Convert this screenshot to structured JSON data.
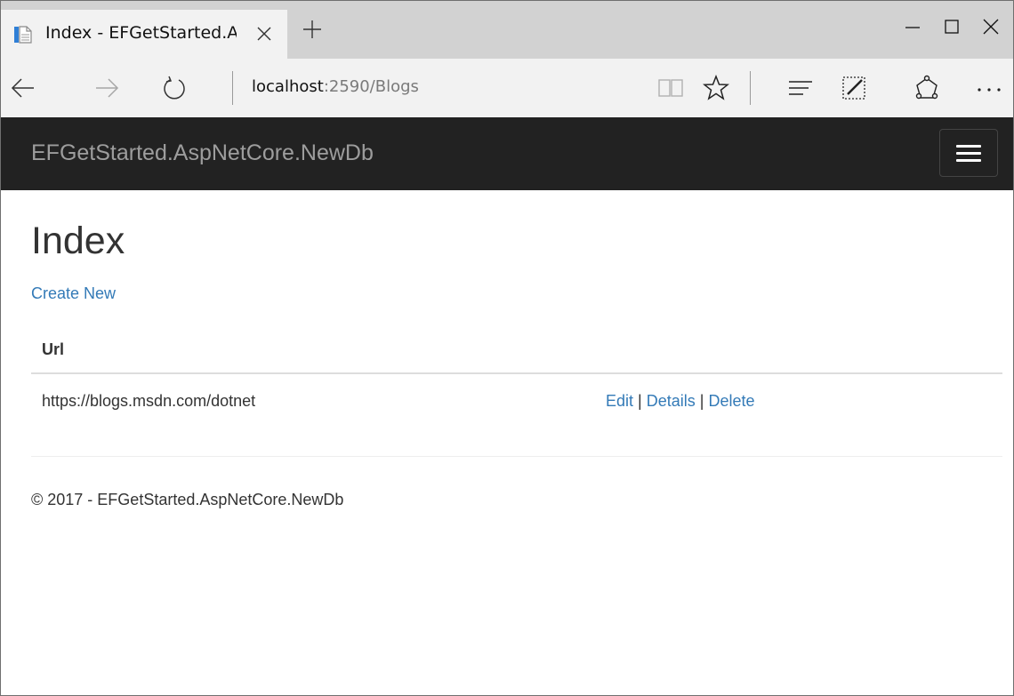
{
  "browser": {
    "tab": {
      "title": "Index - EFGetStarted.As"
    },
    "address": {
      "host": "localhost",
      "rest": ":2590/Blogs"
    },
    "icons": {
      "favicon": "page-icon",
      "close": "close-icon",
      "new_tab": "plus-icon",
      "minimize": "minimize-icon",
      "maximize": "maximize-icon",
      "window_close": "close-icon",
      "back": "arrow-left-icon",
      "forward": "arrow-right-icon",
      "refresh": "refresh-icon",
      "reading_view": "book-icon",
      "favorite": "star-icon",
      "hub": "hub-icon",
      "web_note": "pen-icon",
      "share": "share-icon",
      "more": "ellipsis-icon"
    }
  },
  "site": {
    "brand": "EFGetStarted.AspNetCore.NewDb",
    "navbar_color": "#222222",
    "link_color": "#337ab7"
  },
  "page": {
    "title": "Index",
    "create_link": "Create New",
    "table": {
      "headers": [
        "Url"
      ],
      "rows": [
        {
          "url": "https://blogs.msdn.com/dotnet",
          "actions": [
            "Edit",
            "Details",
            "Delete"
          ],
          "separator": "|"
        }
      ]
    },
    "footer": "© 2017 - EFGetStarted.AspNetCore.NewDb"
  }
}
